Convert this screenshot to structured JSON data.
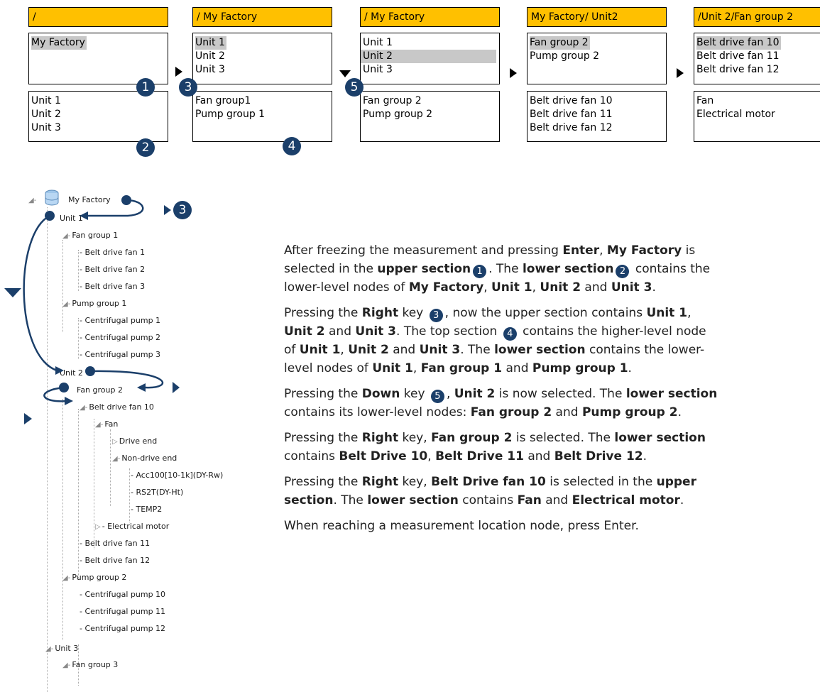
{
  "panels": [
    {
      "header": "/",
      "upper": [
        "My Factory"
      ],
      "lower": [
        "Unit 1",
        "Unit 2",
        "Unit 3"
      ]
    },
    {
      "header": "/ My Factory",
      "upper": [
        "Unit 1",
        "Unit 2",
        "Unit 3"
      ],
      "lower": [
        "Fan group1",
        "Pump group 1"
      ]
    },
    {
      "header": "/ My Factory",
      "upper": [
        "Unit 1",
        "Unit 2",
        "Unit 3"
      ],
      "lower": [
        "Fan group 2",
        "Pump group 2"
      ]
    },
    {
      "header": "My Factory/ Unit2",
      "upper": [
        "Fan group 2",
        "Pump group 2"
      ],
      "lower": [
        "Belt drive fan 10",
        "Belt drive fan 11",
        "Belt drive fan 12"
      ]
    },
    {
      "header": "/Unit 2/Fan group 2",
      "upper": [
        "Belt drive fan 10",
        "Belt drive fan 11",
        "Belt drive fan 12"
      ],
      "lower": [
        "Fan",
        "Electrical motor"
      ]
    }
  ],
  "badges": {
    "b1": "1",
    "b2": "2",
    "b3": "3",
    "b4": "4",
    "b5": "5"
  },
  "tree": [
    "My Factory",
    "Unit 1",
    "Fan group 1",
    "Belt drive fan 1",
    "Belt drive fan 2",
    "Belt drive fan 3",
    "Pump group 1",
    "Centrifugal pump 1",
    "Centrifugal pump 2",
    "Centrifugal pump 3",
    "Unit 2",
    "Fan group 2",
    "Belt drive fan 10",
    "Fan",
    "Drive end",
    "Non-drive end",
    "Acc100[10-1k](DY-Rw)",
    "RS2T(DY-Ht)",
    "TEMP2",
    "Electrical motor",
    "Belt drive fan 11",
    "Belt drive fan 12",
    "Pump group 2",
    "Centrifugal pump 10",
    "Centrifugal pump 11",
    "Centrifugal pump 12",
    "Unit 3",
    "Fan group 3"
  ],
  "text": {
    "p1a_1": "After freezing the measurement and pressing ",
    "p1a_enter": "Enter",
    "p1a_2": ", ",
    "p1a_mf": "My Factory",
    "p1a_3": " is",
    "p1b_1": "selected in the ",
    "p1b_upper": "upper section",
    "p1b_2": ". The ",
    "p1b_lower": "lower section",
    "p1b_3": " contains the",
    "p1c_1": "lower-level nodes of ",
    "p1c_mf": "My Factory",
    "p1c_2": ", ",
    "p1c_u1": "Unit 1",
    "p1c_3": ", ",
    "p1c_u2": "Unit 2",
    "p1c_4": " and ",
    "p1c_u3": "Unit 3",
    "p1c_5": ".",
    "p2a_1": "Pressing the ",
    "p2a_right": "Right",
    "p2a_2": " key ",
    "p2a_3": ", now the upper section contains ",
    "p2a_u1": "Unit 1",
    "p2a_4": ",",
    "p2b_u2": "Unit 2",
    "p2b_1": " and ",
    "p2b_u3": "Unit 3",
    "p2b_2": ". The top section ",
    "p2b_3": " contains the higher-level node",
    "p2c_1": "of ",
    "p2c_u1": "Unit 1",
    "p2c_2": ", ",
    "p2c_u2": "Unit 2",
    "p2c_3": " and ",
    "p2c_u3": "Unit 3",
    "p2c_4": ". The ",
    "p2c_lower": "lower section",
    "p2c_5": " contains the lower-",
    "p2d_1": "level nodes of ",
    "p2d_u1": "Unit 1",
    "p2d_2": ", ",
    "p2d_fg1": "Fan group 1",
    "p2d_3": " and ",
    "p2d_pg1": "Pump group 1",
    "p2d_4": ".",
    "p3a_1": "Pressing the ",
    "p3a_down": "Down",
    "p3a_2": " key ",
    "p3a_3": ", ",
    "p3a_u2": "Unit 2",
    "p3a_4": " is now selected. The ",
    "p3a_lower": "lower section",
    "p3b_1": "contains its lower-level nodes: ",
    "p3b_fg2": "Fan group 2",
    "p3b_2": " and ",
    "p3b_pg2": "Pump group 2",
    "p3b_3": ".",
    "p4a_1": "Pressing the ",
    "p4a_right": "Right",
    "p4a_2": " key, ",
    "p4a_fg2": "Fan group 2",
    "p4a_3": " is selected. The ",
    "p4a_lower": "lower section",
    "p4b_1": "contains ",
    "p4b_b10": "Belt Drive 10",
    "p4b_2": ", ",
    "p4b_b11": "Belt Drive 11",
    "p4b_3": " and ",
    "p4b_b12": "Belt Drive 12",
    "p4b_4": ".",
    "p5a_1": "Pressing the ",
    "p5a_right": "Right",
    "p5a_2": " key, ",
    "p5a_bdf10": "Belt Drive fan 10",
    "p5a_3": " is selected in the ",
    "p5a_upper": "upper",
    "p5b_section": "section",
    "p5b_1": ". The ",
    "p5b_lower": "lower section",
    "p5b_2": " contains ",
    "p5b_fan": "Fan",
    "p5b_3": " and ",
    "p5b_em": "Electrical motor",
    "p5b_4": ".",
    "p6": "When reaching a measurement location node, press Enter."
  },
  "colors": {
    "header": "#FFC000",
    "selection": "#c8c8c8",
    "accent": "#1B3F6A",
    "arrow": "#000000"
  }
}
